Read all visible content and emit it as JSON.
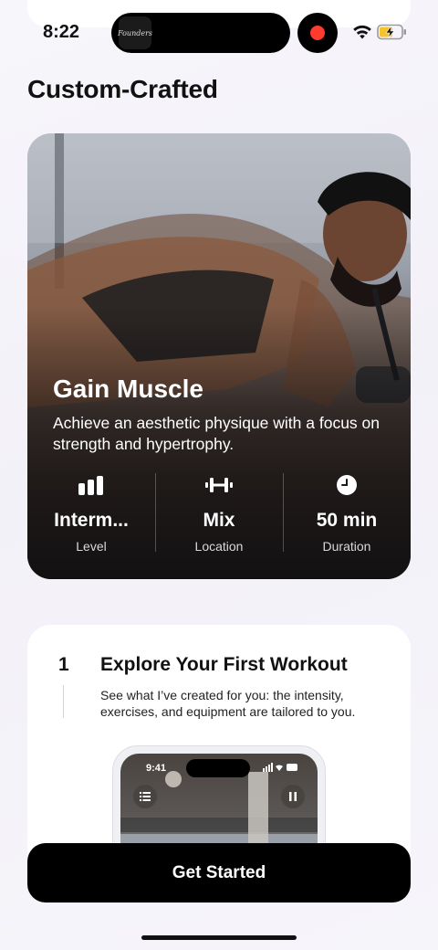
{
  "status_bar": {
    "time": "8:22",
    "island_thumbnail_text": "Founders",
    "recording_color": "#ff3b30",
    "icons": [
      "wifi-icon",
      "battery-charging-icon"
    ]
  },
  "page": {
    "title": "Custom-Crafted"
  },
  "hero_card": {
    "title": "Gain Muscle",
    "description": "Achieve an aesthetic physique with a focus on strength and hypertrophy.",
    "stats": [
      {
        "icon": "bar-chart-icon",
        "value": "Interm...",
        "label": "Level"
      },
      {
        "icon": "dumbbell-icon",
        "value": "Mix",
        "label": "Location"
      },
      {
        "icon": "clock-icon",
        "value": "50 min",
        "label": "Duration"
      }
    ]
  },
  "step": {
    "number": "1",
    "title": "Explore Your First Workout",
    "description": "See what I’ve created for you: the intensity, exercises, and equipment are tailored to you.",
    "preview": {
      "time": "9:41",
      "icons": [
        "list-icon",
        "pause-icon"
      ]
    }
  },
  "cta": {
    "label": "Get Started"
  },
  "colors": {
    "background": "#f5f4f9",
    "card": "#ffffff",
    "cta_background": "#000000",
    "text": "#111111"
  }
}
